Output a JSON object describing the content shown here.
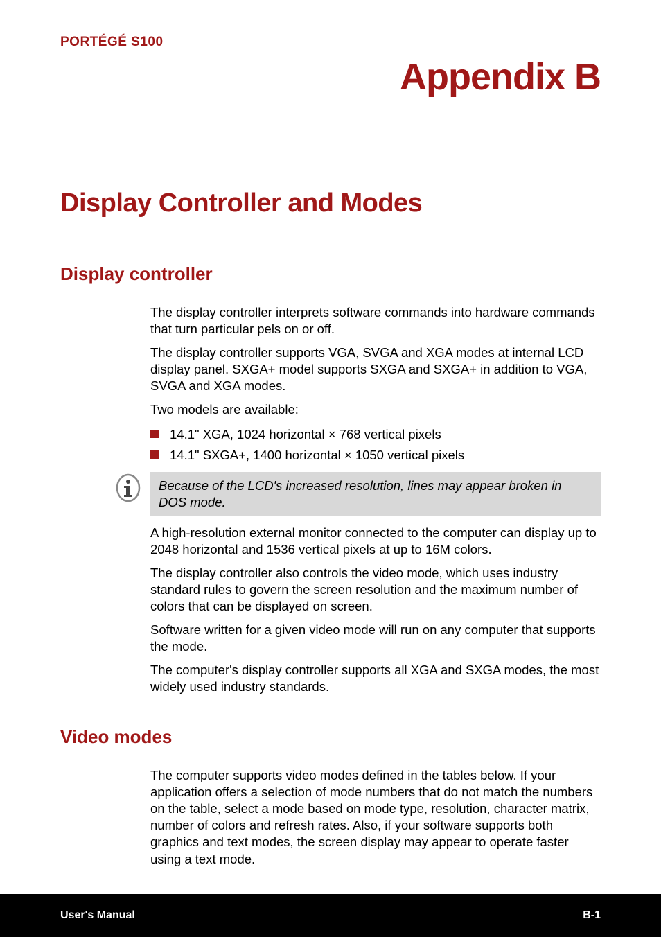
{
  "header": {
    "product": "PORTÉGÉ S100",
    "appendix": "Appendix B"
  },
  "main_title": "Display Controller and Modes",
  "section1": {
    "heading": "Display controller",
    "para1": "The display controller interprets software commands into hardware commands that turn particular pels on or off.",
    "para2": "The display controller supports VGA, SVGA and XGA modes at internal LCD display panel. SXGA+ model supports SXGA and SXGA+ in addition to VGA, SVGA and XGA modes.",
    "para3": "Two models are available:",
    "bullets": [
      "14.1\" XGA, 1024 horizontal × 768 vertical pixels",
      "14.1\" SXGA+, 1400 horizontal × 1050 vertical pixels"
    ],
    "note": "Because of the LCD's increased resolution, lines may appear broken in DOS mode.",
    "para4": "A high-resolution external monitor connected to the computer can display up to 2048 horizontal and 1536 vertical pixels at up to 16M colors.",
    "para5": "The display controller also controls the video mode, which uses industry standard rules to govern the screen resolution and the maximum number of colors that can be displayed on screen.",
    "para6": "Software written for a given video mode will run on any computer that supports the mode.",
    "para7": "The computer's display controller supports all XGA and SXGA modes, the most widely used industry standards."
  },
  "section2": {
    "heading": "Video modes",
    "para1": "The computer supports video modes defined in the tables below. If your application offers a selection of mode numbers that do not match the numbers on the table, select a mode based on mode type, resolution, character matrix, number of colors and refresh rates. Also, if your software supports both graphics and text modes, the screen display may appear to operate faster using a text mode."
  },
  "footer": {
    "left": "User's Manual",
    "right": "B-1"
  }
}
